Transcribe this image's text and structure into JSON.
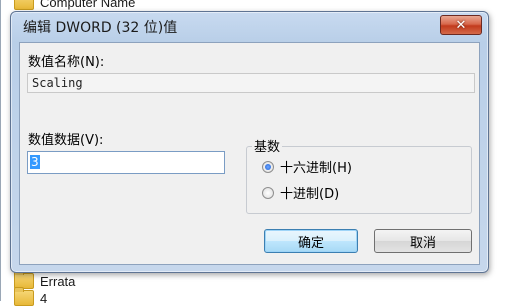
{
  "background": {
    "top_item": "Computer Name",
    "bottom_item_1": "Errata",
    "bottom_item_2": "4"
  },
  "dialog": {
    "title": "编辑 DWORD (32 位)值",
    "close_label": "✕",
    "name_label": "数值名称(N):",
    "name_value": "Scaling",
    "data_label": "数值数据(V):",
    "data_value": "3",
    "base": {
      "legend": "基数",
      "options": [
        "十六进制(H)",
        "十进制(D)"
      ],
      "selected": "十六进制(H)"
    },
    "ok_label": "确定",
    "cancel_label": "取消"
  },
  "colors": {
    "selection": "#3399ff",
    "close_button": "#c23a1c",
    "titlebar": "#b9cfe8"
  }
}
